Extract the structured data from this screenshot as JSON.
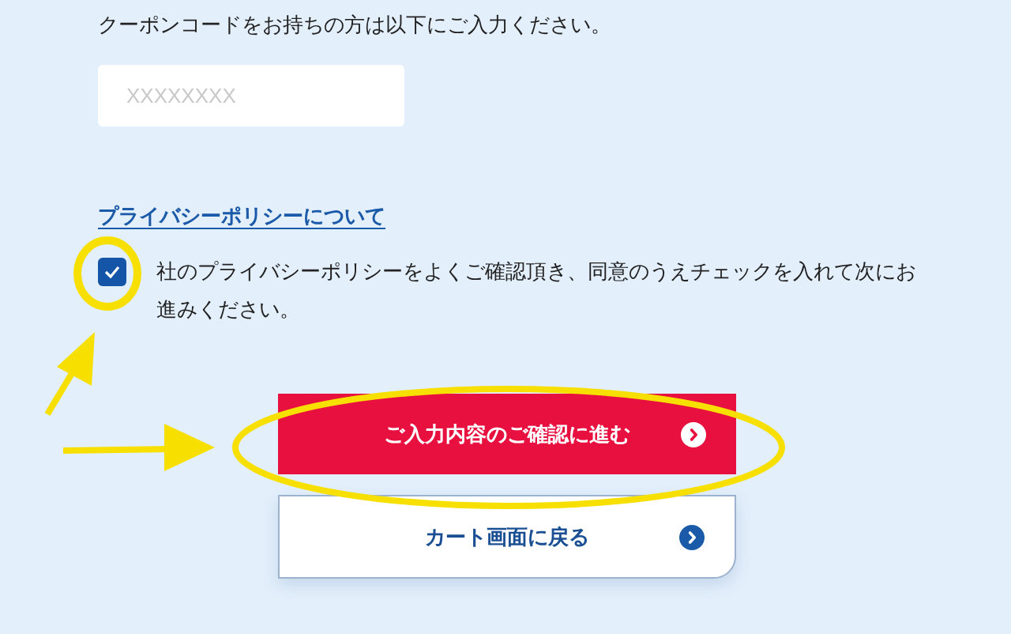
{
  "coupon": {
    "instruction": "クーポンコードをお持ちの方は以下にご入力ください。",
    "placeholder": "XXXXXXXX"
  },
  "privacy": {
    "link": "プライバシーポリシーについて",
    "consent": "社のプライバシーポリシーをよくご確認頂き、同意のうえチェックを入れて次にお進みください。",
    "checked": true
  },
  "buttons": [
    {
      "kind": "primary",
      "label": "ご入力内容のご確認に進む"
    },
    {
      "kind": "secondary",
      "label": "カート画面に戻る"
    }
  ]
}
